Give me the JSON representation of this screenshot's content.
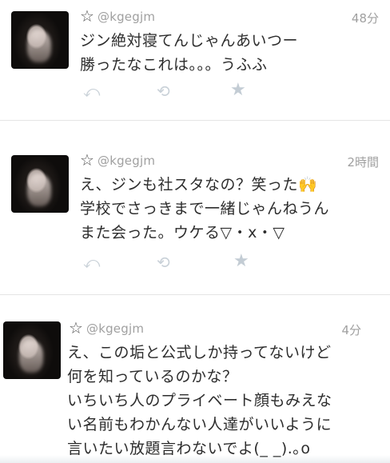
{
  "tweets": [
    {
      "handle": "@kgegjm",
      "time": "48分",
      "lines": [
        "ジン絶対寝てんじゃんあいつー",
        "勝ったなこれは。。。うふふ"
      ]
    },
    {
      "handle": "@kgegjm",
      "time": "2時間",
      "lines": [
        "え、ジンも社スタなの？笑った🙌",
        "学校でさっきまで一緒じゃんねうん",
        "また会った。ウケる▽・x・▽"
      ]
    },
    {
      "handle": "@kgegjm",
      "time": "4分",
      "lines": [
        "え、この垢と公式しか持ってないけど",
        "何を知っているのかな？",
        "いちいち人のプライベート顔もみえな",
        "い名前もわかんない人達がいいように",
        "言いたい放題言わないでよ(_ _).｡o"
      ]
    }
  ],
  "icons": {
    "star": "☆",
    "reply": "⤺",
    "retweet": "⟲",
    "favorite": "★"
  }
}
